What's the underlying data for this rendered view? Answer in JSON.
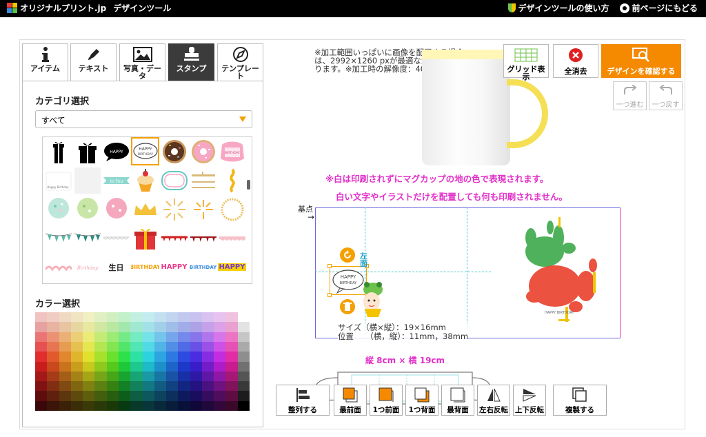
{
  "header": {
    "logo_text": "オリジナルプリント.jp",
    "tool_name": "デザインツール",
    "howto_label": "デザインツールの使い方",
    "back_label": "前ページにもどる"
  },
  "tabs": [
    {
      "label": "アイテム",
      "icon": "info-icon",
      "active": false
    },
    {
      "label": "テキスト",
      "icon": "pen-icon",
      "active": false
    },
    {
      "label": "写真・データ",
      "icon": "image-icon",
      "active": false
    },
    {
      "label": "スタンプ",
      "icon": "stamp-icon",
      "active": true
    },
    {
      "label": "テンプレート",
      "icon": "compass-icon",
      "active": false
    }
  ],
  "left_panel": {
    "category_title": "カテゴリ選択",
    "category_value": "すべて",
    "color_title": "カラー選択",
    "stamp_texts": {
      "happy_birthday": "HAPPY BIRTHDAY",
      "birthday": "BIRTHDAY",
      "happy": "HAPPY",
      "to_you": "to You",
      "seisei": "生日"
    }
  },
  "canvas": {
    "note": "※加工範囲いっぱいに画像を配置する場合は、2992×1260 pxが最適な大きさになります。※加工時の解像度：400dpi",
    "pink_note_1": "※白は印刷されずにマグカップの地の色で表現されます。",
    "pink_note_2": "白い文字やイラストだけを配置しても何も印刷されません。",
    "origin_label": "基点",
    "left_handle_label": "左面",
    "size_line": "サイズ（横×縦）：19×16mm",
    "position_line": "位置　　（横，縦）：11mm，38mm",
    "dims": "縦 8cm × 横 19cm",
    "handprint_text": "HAPPY BIRTHDAY"
  },
  "toolbar": {
    "grid_label": "グリッド表示",
    "clear_label": "全消去",
    "confirm_label": "デザインを確認する",
    "redo_label": "一つ進む",
    "undo_label": "一つ戻す"
  },
  "bottom_bar": {
    "align": "整列する",
    "front_most": "最前面",
    "forward": "1つ前面",
    "backward": "1つ背面",
    "back_most": "最背面",
    "flip_h": "左右反転",
    "flip_v": "上下反転",
    "duplicate": "複製する"
  },
  "colors": {
    "accent": "#f58a00",
    "active_tab": "#3b3b3b",
    "pink_text": "#e22fc8",
    "mug_inside": "#f4df55"
  }
}
